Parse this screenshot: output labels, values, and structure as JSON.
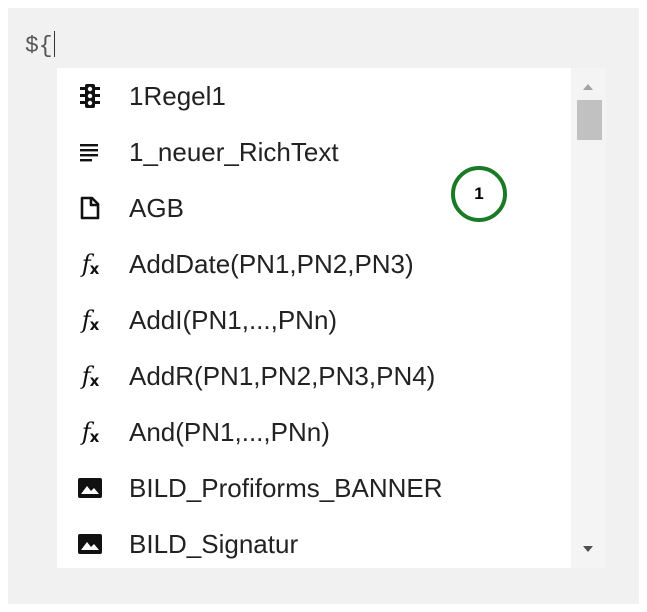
{
  "editor": {
    "input_text": "${"
  },
  "autocomplete": {
    "items": [
      {
        "icon": "traffic-light-icon",
        "label": "1Regel1"
      },
      {
        "icon": "rich-text-icon",
        "label": "1_neuer_RichText"
      },
      {
        "icon": "document-icon",
        "label": "AGB"
      },
      {
        "icon": "function-icon",
        "label": "AddDate(PN1,PN2,PN3)"
      },
      {
        "icon": "function-icon",
        "label": "AddI(PN1,...,PNn)"
      },
      {
        "icon": "function-icon",
        "label": "AddR(PN1,PN2,PN3,PN4)"
      },
      {
        "icon": "function-icon",
        "label": "And(PN1,...,PNn)"
      },
      {
        "icon": "image-icon",
        "label": "BILD_Profiforms_BANNER"
      },
      {
        "icon": "image-icon",
        "label": "BILD_Signatur"
      }
    ]
  },
  "callout": {
    "number": "1",
    "color": "#1a7a26"
  }
}
